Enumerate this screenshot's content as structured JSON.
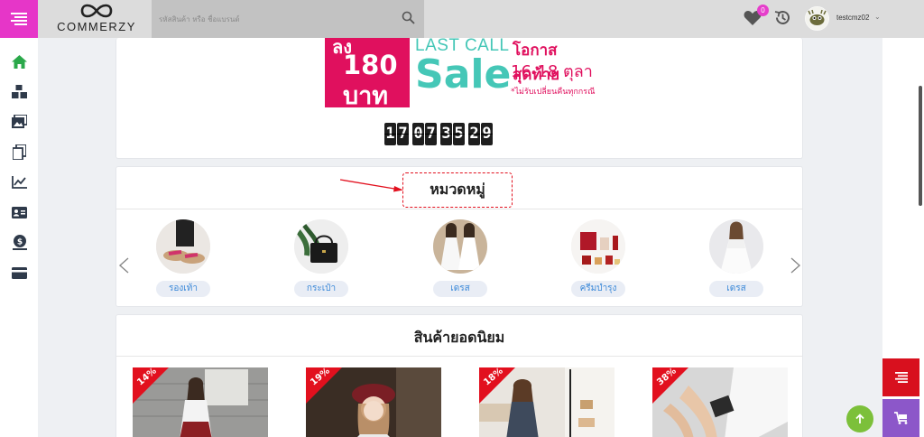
{
  "app": {
    "brand": "COMMERZY",
    "search_placeholder": "รหัสสินค้า หรือ ชื่อแบรนด์",
    "wishlist_count": "0",
    "username": "testcmz02"
  },
  "sidebar": {
    "items": [
      {
        "icon": "home-icon"
      },
      {
        "icon": "boxes-icon"
      },
      {
        "icon": "images-icon"
      },
      {
        "icon": "copy-icon"
      },
      {
        "icon": "chart-line-icon"
      },
      {
        "icon": "id-card-icon"
      },
      {
        "icon": "money-icon"
      },
      {
        "icon": "credit-card-icon"
      }
    ]
  },
  "banner": {
    "left_top": "ลง",
    "left_number": "180",
    "left_unit": "บาท",
    "headline": "LAST CALL",
    "sale_word": "Sale",
    "chance_text": "โอกาส สุดท้าย",
    "date_text": "16-18 ตุลา",
    "note_text": "*ไม่รับเปลี่ยนคืนทุกกรณี"
  },
  "countdown": {
    "groups": [
      {
        "digits": [
          "1",
          "7"
        ]
      },
      {
        "digits": [
          "0",
          "7"
        ]
      },
      {
        "digits": [
          "3",
          "5"
        ]
      },
      {
        "digits": [
          "2",
          "9"
        ]
      }
    ]
  },
  "categories": {
    "title": "หมวดหมู่",
    "items": [
      {
        "label": "รองเท้า"
      },
      {
        "label": "กระเป๋า"
      },
      {
        "label": "เดรส"
      },
      {
        "label": "ครีมบำรุง"
      },
      {
        "label": "เดรส"
      }
    ]
  },
  "popular": {
    "title": "สินค้ายอดนิยม",
    "products": [
      {
        "discount": "14%"
      },
      {
        "discount": "19%"
      },
      {
        "discount": "18%"
      },
      {
        "discount": "38%"
      }
    ]
  },
  "colors": {
    "menu_accent": "#e636c8",
    "brand_red": "#e2101e",
    "link_blue": "#3a88d8",
    "cart_purple": "#8c57c9",
    "back_top_green": "#7cc03a"
  }
}
